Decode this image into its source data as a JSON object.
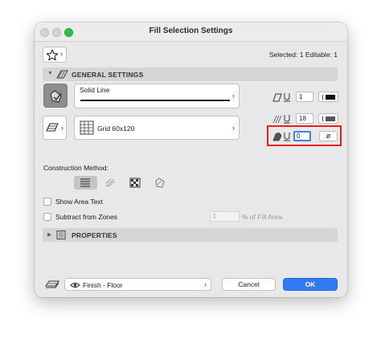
{
  "window": {
    "title": "Fill Selection Settings"
  },
  "header": {
    "selection_info": "Selected: 1 Editable: 1"
  },
  "general_settings": {
    "label": "GENERAL SETTINGS",
    "line_type": "Solid Line",
    "fill_pattern": "Grid 60x120",
    "fill_pen": "1",
    "background_pen": "18",
    "background_pen_active": "0",
    "null_symbol": "ø"
  },
  "construction": {
    "label": "Construction Method:",
    "show_area_text": "Show Area Text",
    "subtract_from_zones": "Subtract from Zones",
    "percent_value": "0",
    "percent_label": "% of Fill Area"
  },
  "properties": {
    "label": "PROPERTIES"
  },
  "footer": {
    "favorite": "Finish - Floor",
    "cancel": "Cancel",
    "ok": "OK"
  },
  "colors": {
    "accent": "#2f7bf6",
    "highlight": "#e2221b",
    "traffic_green": "#29c33f"
  }
}
